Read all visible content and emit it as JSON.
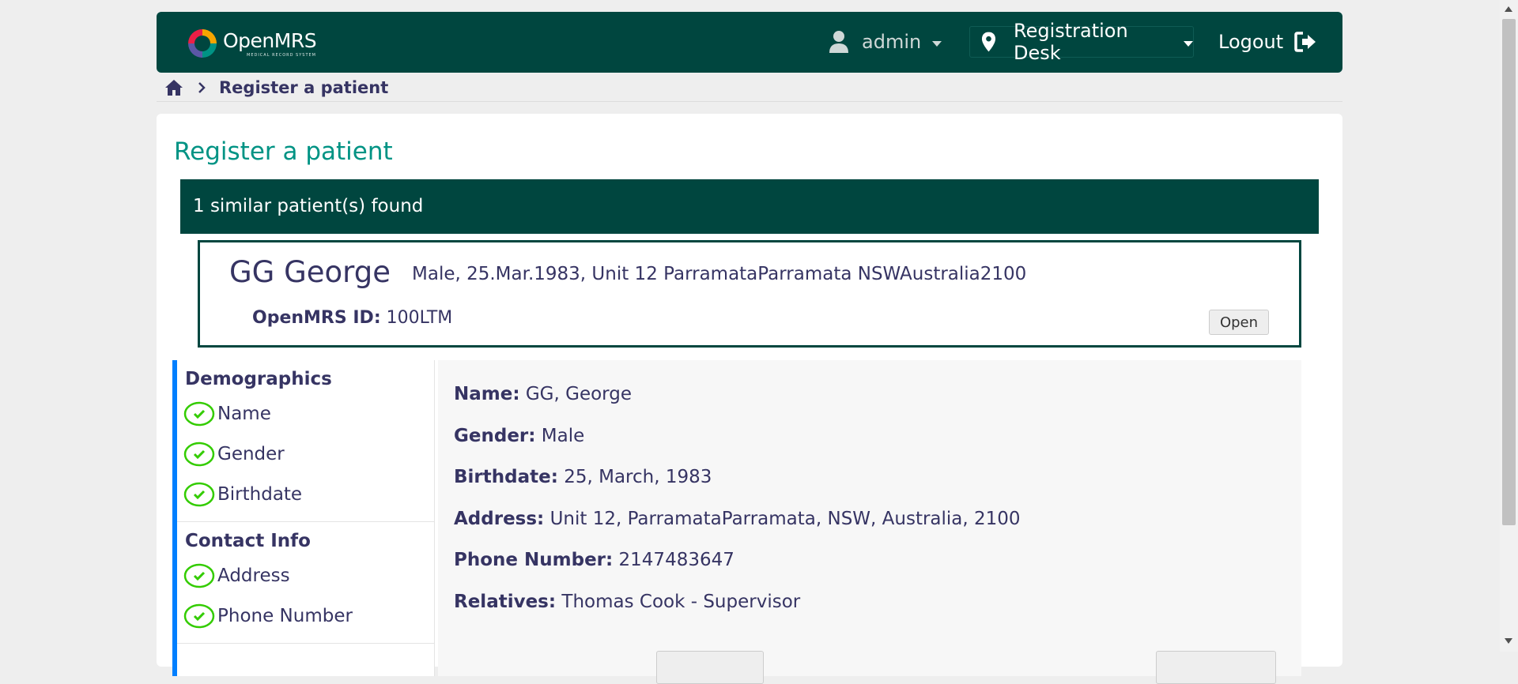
{
  "header": {
    "logo_text": "OpenMRS",
    "logo_subtext": "MEDICAL RECORD SYSTEM",
    "user_label": "admin",
    "location_label": "Registration Desk",
    "logout_label": "Logout"
  },
  "breadcrumb": {
    "current": "Register a patient"
  },
  "page": {
    "title": "Register a patient",
    "similar_banner": "1 similar patient(s) found"
  },
  "similar_patient": {
    "name": "GG George",
    "details": "Male, 25.Mar.1983, Unit 12 ParramataParramata NSWAustralia2100",
    "id_label": "OpenMRS ID:",
    "id_value": "100LTM",
    "open_label": "Open"
  },
  "side_nav": {
    "sections": [
      {
        "title": "Demographics",
        "items": [
          "Name",
          "Gender",
          "Birthdate"
        ]
      },
      {
        "title": "Contact Info",
        "items": [
          "Address",
          "Phone Number"
        ]
      }
    ]
  },
  "confirmation": {
    "rows": [
      {
        "label": "Name:",
        "value": "GG, George"
      },
      {
        "label": "Gender:",
        "value": "Male"
      },
      {
        "label": "Birthdate:",
        "value": "25, March, 1983"
      },
      {
        "label": "Address:",
        "value": "Unit 12, ParramataParramata, NSW, Australia, 2100"
      },
      {
        "label": "Phone Number:",
        "value": "2147483647"
      },
      {
        "label": "Relatives:",
        "value": "Thomas Cook - Supervisor"
      }
    ]
  },
  "colors": {
    "header_bg": "#00463f",
    "title_teal": "#009384",
    "nav_accent": "#007fff",
    "check_green": "#33cc00",
    "text_primary": "#363463"
  },
  "icons": {
    "logo": "openmrs-logo-icon",
    "user": "user-icon",
    "location": "map-marker-icon",
    "logout": "sign-out-icon",
    "home": "home-icon",
    "check": "check-circle-icon"
  }
}
